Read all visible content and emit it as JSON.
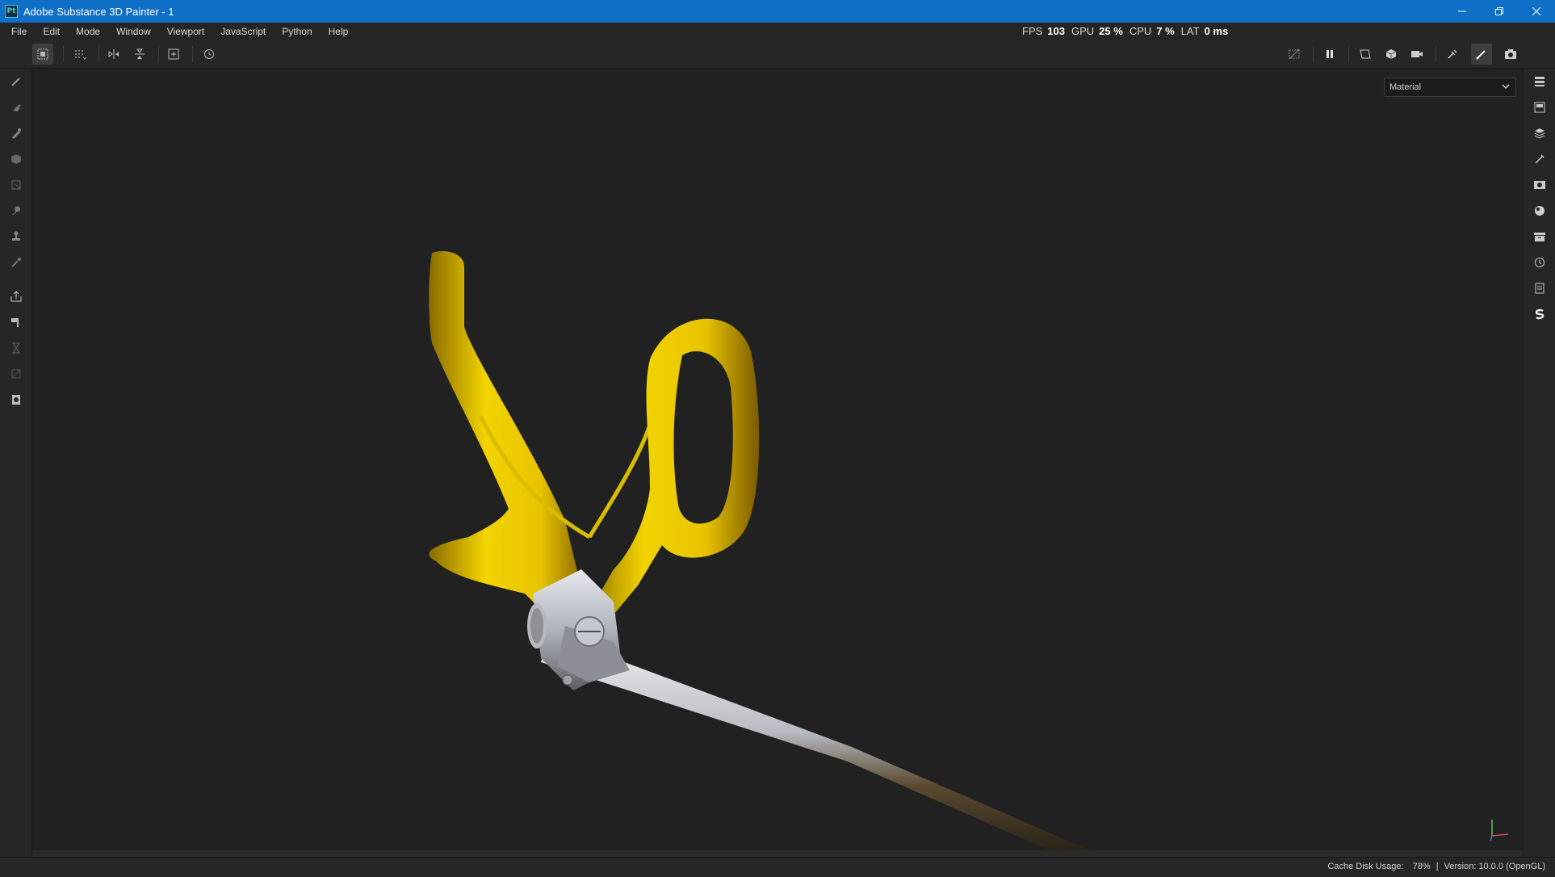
{
  "window": {
    "title": "Adobe Substance 3D Painter - 1",
    "logo_text": "Pt",
    "controls": [
      "minimize-icon",
      "restore-icon",
      "close-icon"
    ]
  },
  "menu": {
    "items": [
      "File",
      "Edit",
      "Mode",
      "Window",
      "Viewport",
      "JavaScript",
      "Python",
      "Help"
    ]
  },
  "stats": {
    "fps_label": "FPS",
    "fps_value": "103",
    "gpu_label": "GPU",
    "gpu_value": "25 %",
    "cpu_label": "CPU",
    "cpu_value": "7 %",
    "lat_label": "LAT",
    "lat_value": "0 ms"
  },
  "toolbar": {
    "left_icons": [
      "uv-tile-select-icon",
      "dotted-grid-icon",
      "symmetry-x-icon",
      "symmetry-y-icon",
      "add-frame-icon",
      "reset-icon"
    ],
    "right_icons": [
      "hide-icon",
      "pause-icon",
      "viewport-2d-icon",
      "viewport-3d-icon",
      "camera-icon",
      "bake-icon",
      "paint-mode-icon",
      "screenshot-icon"
    ]
  },
  "left_tools": [
    "paint-brush-icon",
    "eraser-icon",
    "projection-icon",
    "polygon-fill-icon",
    "geometry-mask-icon",
    "smudge-icon",
    "clone-stamp-icon",
    "color-picker-icon",
    "export-icon",
    "bake-hammer-icon",
    "hourglass-icon",
    "uv-icon",
    "texture-set-icon"
  ],
  "right_panels": [
    "layers-list-icon",
    "texture-set-list-icon",
    "layers-icon",
    "properties-icon",
    "display-settings-icon",
    "shader-settings-icon",
    "assets-icon",
    "history-icon",
    "log-icon",
    "substance-icon"
  ],
  "viewport": {
    "mode_select": "Material"
  },
  "status": {
    "cache_label": "Cache Disk Usage:",
    "cache_value": "78%",
    "version": "Version: 10.0.0 (OpenGL)"
  },
  "colors": {
    "titlebar": "#0f6fc6",
    "background": "#212121",
    "panel": "#262626",
    "handle_gold": "#e6c400",
    "metal_silver": "#c8cdd3"
  }
}
